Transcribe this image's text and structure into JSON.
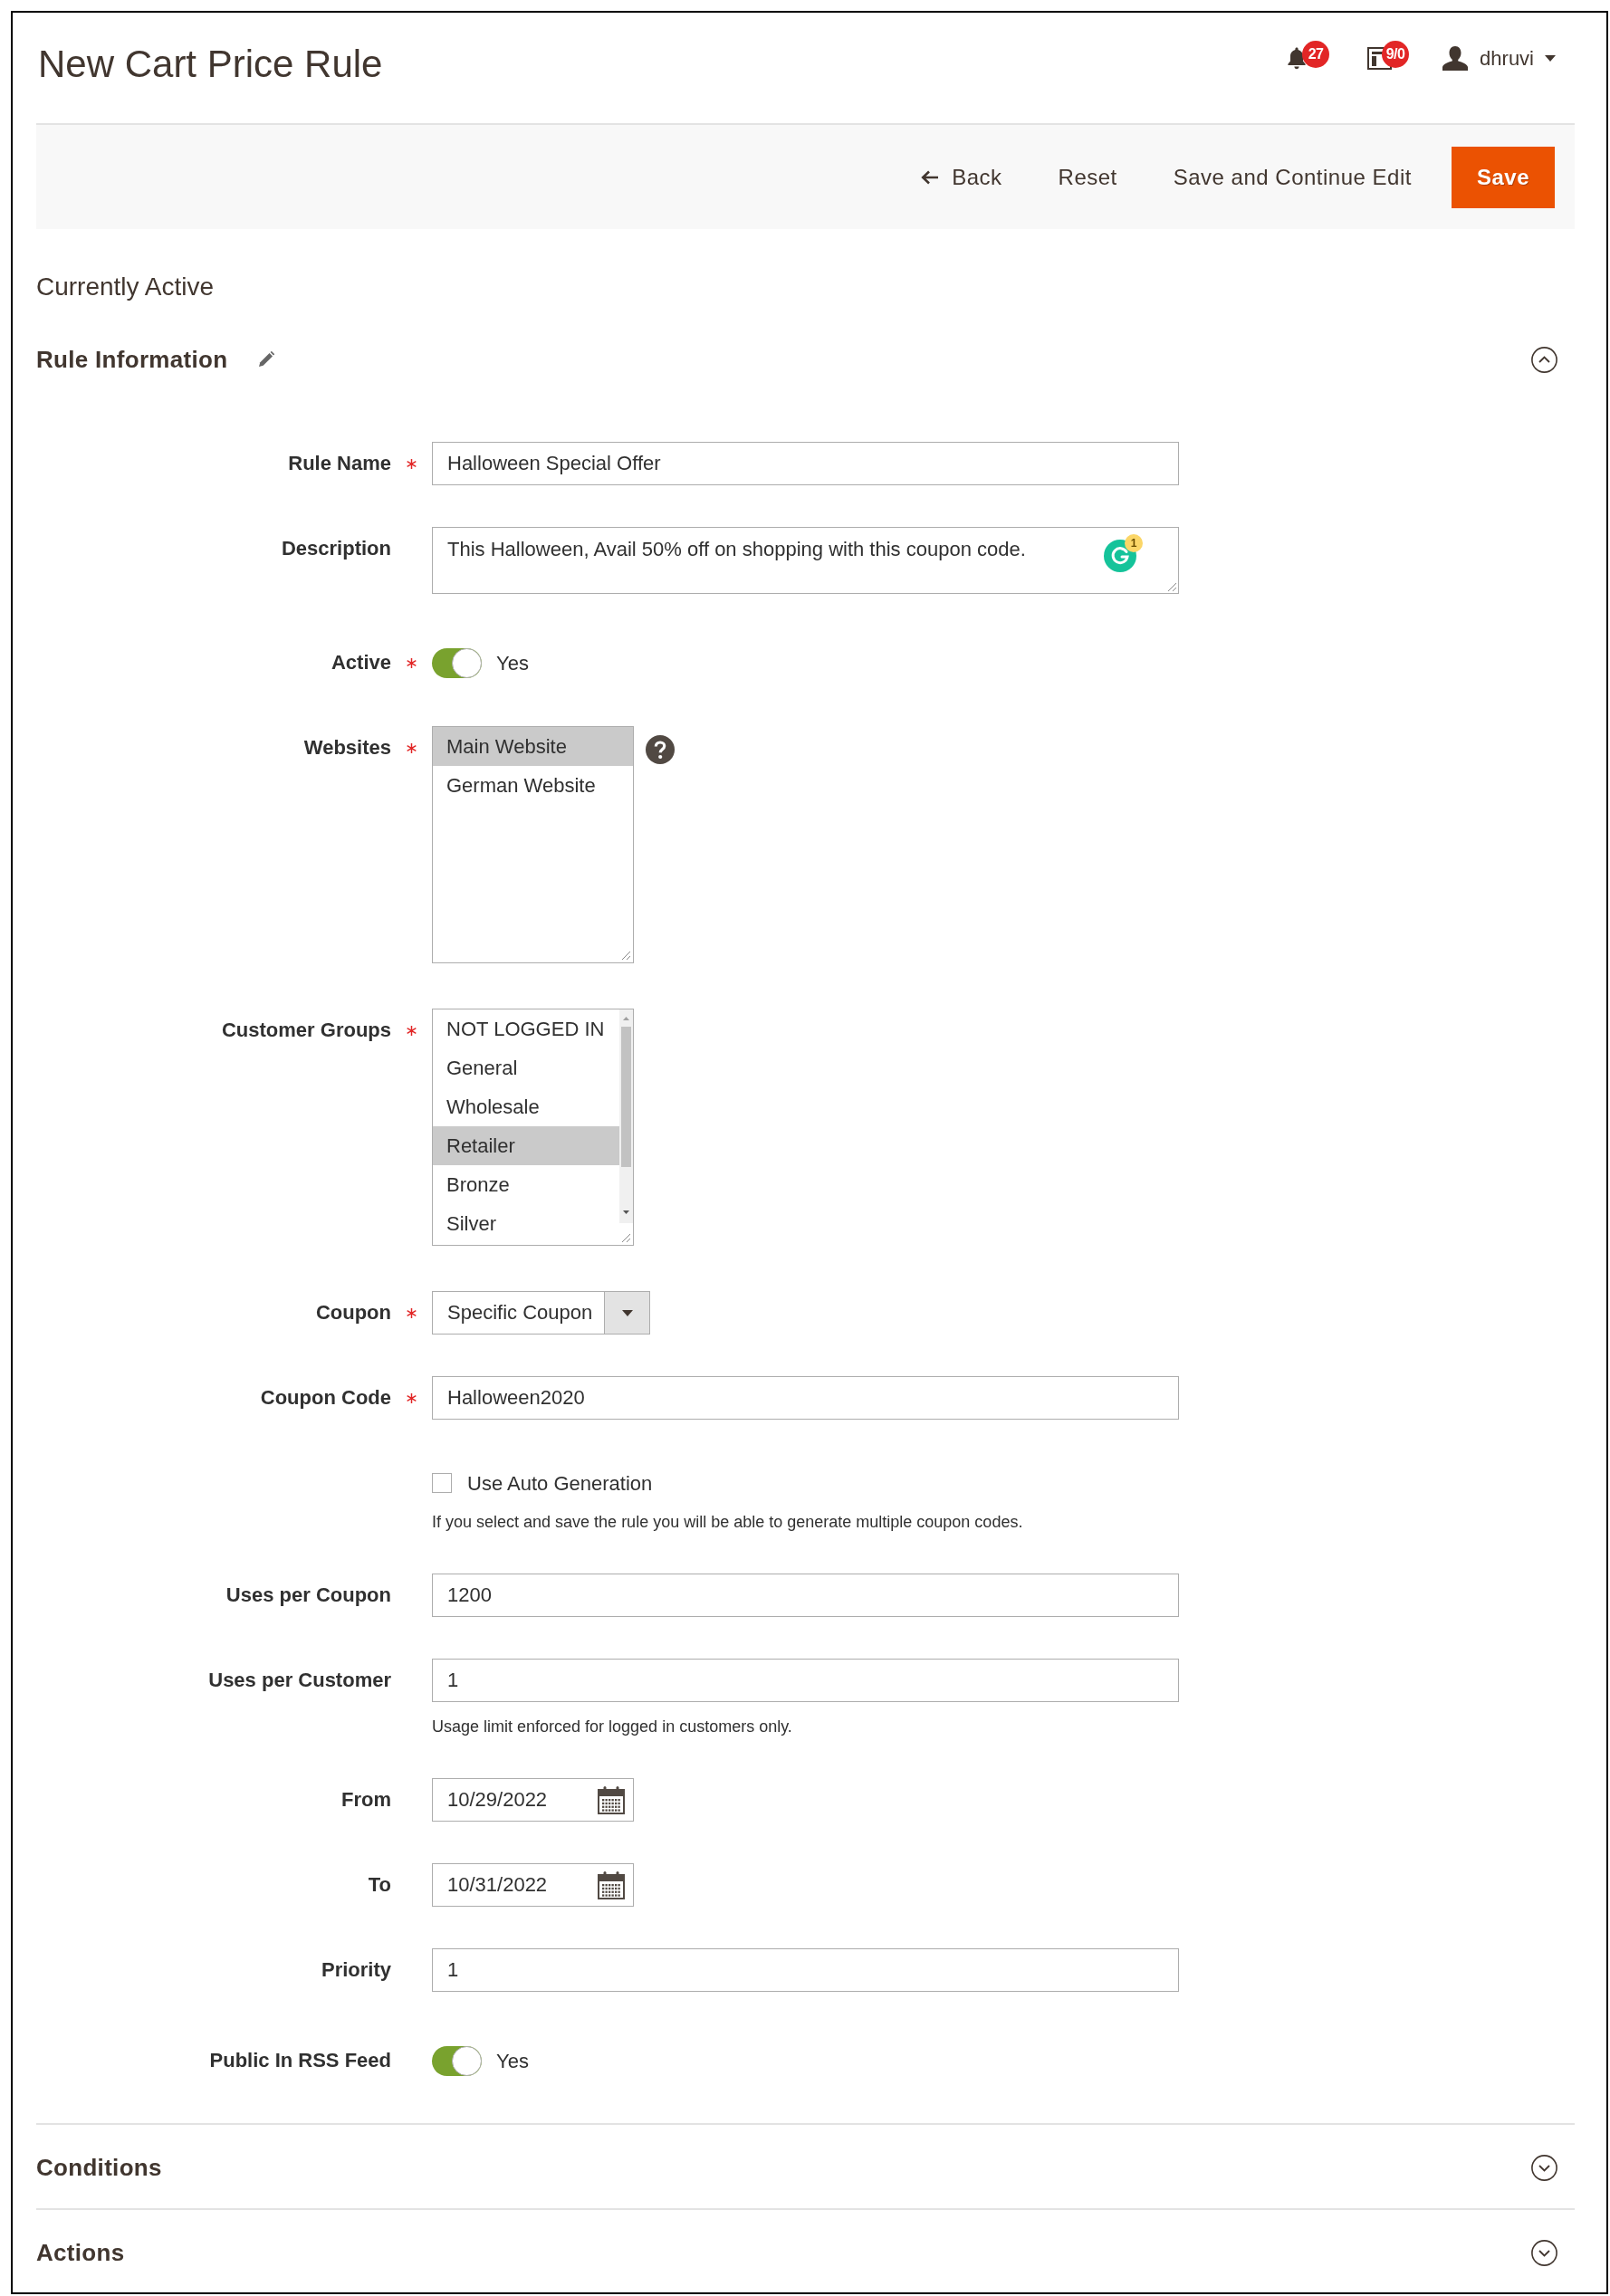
{
  "page_title": "New Cart Price Rule",
  "header": {
    "notifications": {
      "count": "27"
    },
    "system_messages": {
      "count": "9/0"
    },
    "user": {
      "name": "dhruvi"
    }
  },
  "actions": [
    {
      "kind": "back",
      "label": "Back"
    },
    {
      "kind": "plain",
      "label": "Reset"
    },
    {
      "kind": "plain",
      "label": "Save and Continue Edit"
    },
    {
      "kind": "primary",
      "label": "Save"
    }
  ],
  "status": "Currently Active",
  "sections": [
    {
      "title": "Rule Information",
      "editable": true,
      "expanded": true,
      "fields": [
        {
          "kind": "text",
          "label": "Rule Name",
          "required": true,
          "value": "Halloween Special Offer"
        },
        {
          "kind": "textarea",
          "label": "Description",
          "required": false,
          "value": "This Halloween, Avail 50% off on shopping with this coupon code.",
          "assistant_alerts": "1"
        },
        {
          "kind": "toggle",
          "label": "Active",
          "required": true,
          "on": true,
          "text": "Yes"
        },
        {
          "kind": "multiselect",
          "label": "Websites",
          "required": true,
          "help": true,
          "options": [
            {
              "label": "Main Website",
              "selected": true
            },
            {
              "label": "German Website",
              "selected": false
            }
          ]
        },
        {
          "kind": "multiselect",
          "label": "Customer Groups",
          "required": true,
          "scrollbar": true,
          "options": [
            {
              "label": "NOT LOGGED IN",
              "selected": false
            },
            {
              "label": "General",
              "selected": false
            },
            {
              "label": "Wholesale",
              "selected": false
            },
            {
              "label": "Retailer",
              "selected": true
            },
            {
              "label": "Bronze",
              "selected": false
            },
            {
              "label": "Silver",
              "selected": false
            }
          ]
        },
        {
          "kind": "select",
          "label": "Coupon",
          "required": true,
          "value": "Specific Coupon"
        },
        {
          "kind": "text",
          "label": "Coupon Code",
          "required": true,
          "value": "Halloween2020"
        },
        {
          "kind": "checkbox",
          "label": "Use Auto Generation",
          "required": false,
          "checked": false,
          "note": "If you select and save the rule you will be able to generate multiple coupon codes."
        },
        {
          "kind": "text",
          "label": "Uses per Coupon",
          "required": false,
          "value": "1200"
        },
        {
          "kind": "text",
          "label": "Uses per Customer",
          "required": false,
          "value": "1",
          "note": "Usage limit enforced for logged in customers only."
        },
        {
          "kind": "date",
          "label": "From",
          "required": false,
          "value": "10/29/2022"
        },
        {
          "kind": "date",
          "label": "To",
          "required": false,
          "value": "10/31/2022"
        },
        {
          "kind": "text",
          "label": "Priority",
          "required": false,
          "value": "1"
        },
        {
          "kind": "toggle",
          "label": "Public In RSS Feed",
          "required": false,
          "on": true,
          "text": "Yes"
        }
      ]
    },
    {
      "title": "Conditions",
      "editable": false,
      "expanded": false
    },
    {
      "title": "Actions",
      "editable": false,
      "expanded": false
    }
  ]
}
